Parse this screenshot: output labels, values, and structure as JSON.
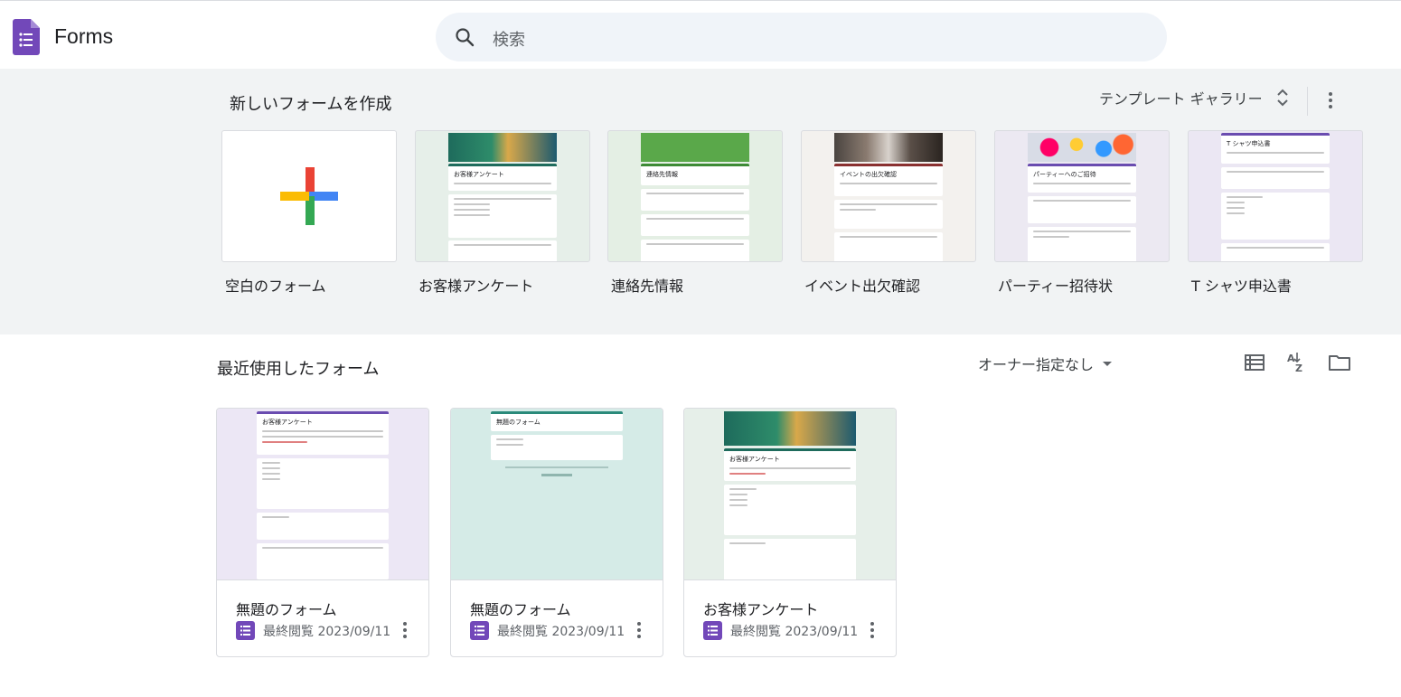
{
  "header": {
    "app_name": "Forms",
    "search_placeholder": "検索"
  },
  "templates": {
    "title": "新しいフォームを作成",
    "gallery_label": "テンプレート ギャラリー",
    "items": [
      {
        "label": "空白のフォーム"
      },
      {
        "label": "お客様アンケート",
        "preview_title": "お客様アンケート"
      },
      {
        "label": "連絡先情報",
        "preview_title": "連絡先情報"
      },
      {
        "label": "イベント出欠確認",
        "preview_title": "イベントの出欠確認"
      },
      {
        "label": "パーティー招待状",
        "preview_title": "パーティーへのご招待"
      },
      {
        "label": "T シャツ申込書",
        "preview_title": "T シャツ申込書"
      }
    ]
  },
  "recent": {
    "title": "最近使用したフォーム",
    "owner_filter": "オーナー指定なし",
    "cards": [
      {
        "title": "無題のフォーム",
        "meta": "最終閲覧 2023/09/11",
        "preview_title": "お客様アンケート"
      },
      {
        "title": "無題のフォーム",
        "meta": "最終閲覧 2023/09/11",
        "preview_title": "無題のフォーム"
      },
      {
        "title": "お客様アンケート",
        "meta": "最終閲覧 2023/09/11",
        "preview_title": "お客様アンケート"
      }
    ]
  },
  "colors": {
    "forms_purple": "#7248b9",
    "section_bg": "#f1f3f4",
    "search_bg": "#f0f4f9"
  },
  "icons": [
    "forms-logo-icon",
    "search-icon",
    "unfold-icon",
    "more-vert-icon",
    "list-view-icon",
    "sort-az-icon",
    "folder-icon",
    "forms-file-icon",
    "plus-icon"
  ]
}
